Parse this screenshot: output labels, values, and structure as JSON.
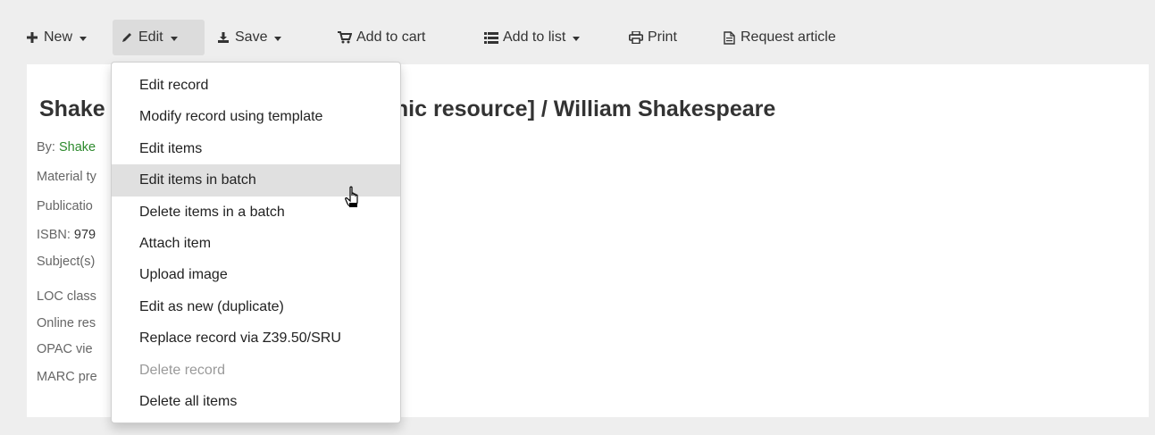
{
  "toolbar": {
    "new_label": "New",
    "edit_label": "Edit",
    "save_label": "Save",
    "add_to_cart_label": "Add to cart",
    "add_to_list_label": "Add to list",
    "print_label": "Print",
    "request_article_label": "Request article"
  },
  "record": {
    "title_visible_start": "Shake",
    "title_visible_end": "ctronic resource] / William Shakespeare",
    "by_label": "By: ",
    "author_visible": "Shake",
    "material_type_visible": "Material ty",
    "publication_visible": "Publicatio",
    "isbn_label": "ISBN: ",
    "isbn_visible": "979",
    "subjects_visible": "Subject(s)",
    "loc_class_visible": "LOC class",
    "online_resource_visible": "Online res",
    "opac_view_visible": "OPAC vie",
    "marc_preview_visible": "MARC pre"
  },
  "edit_menu": {
    "items": [
      {
        "label": "Edit record"
      },
      {
        "label": "Modify record using template"
      },
      {
        "label": "Edit items"
      },
      {
        "label": "Edit items in batch"
      },
      {
        "label": "Delete items in a batch"
      },
      {
        "label": "Attach item"
      },
      {
        "label": "Upload image"
      },
      {
        "label": "Edit as new (duplicate)"
      },
      {
        "label": "Replace record via Z39.50/SRU"
      },
      {
        "label": "Delete record"
      },
      {
        "label": "Delete all items"
      }
    ],
    "hovered_item": "Edit items in batch",
    "disabled_item": "Delete record"
  },
  "colors": {
    "page_background": "#eeeeee",
    "author_link": "#2d8a2d",
    "menu_hover": "#e0e0e0",
    "disabled_text": "#9a9a9a"
  }
}
